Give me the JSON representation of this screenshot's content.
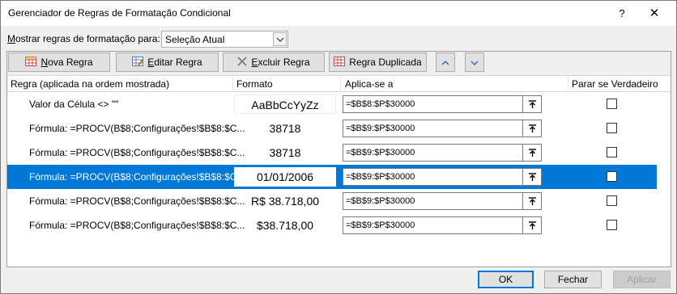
{
  "window": {
    "title": "Gerenciador de Regras de Formatação Condicional",
    "help_glyph": "?",
    "close_glyph": "✕"
  },
  "show_rules": {
    "label_acc": "M",
    "label_rest": "ostrar regras de formatação para:",
    "selected": "Seleção Atual"
  },
  "toolbar": {
    "new_acc": "N",
    "new_rest": "ova Regra",
    "edit_acc": "E",
    "edit_rest": "ditar Regra",
    "delete_acc": "E",
    "delete_rest": "xcluir Regra",
    "duplicate_label": "Regra Duplicada",
    "move_up_glyph": "∧",
    "move_down_glyph": "∨"
  },
  "columns": {
    "rule": "Regra (aplicada na ordem mostrada)",
    "format": "Formato",
    "applies_to": "Aplica-se a",
    "stop_if_true": "Parar se Verdadeiro"
  },
  "rules": [
    {
      "rule": "Valor da Célula <> \"\"",
      "preview": "AaBbCcYyZz",
      "applies_to": "=$B$8:$P$30000",
      "stop_if_true": false,
      "selected": false
    },
    {
      "rule": "Fórmula: =PROCV(B$8;Configurações!$B$8:$C...",
      "preview": "38718",
      "applies_to": "=$B$9:$P$30000",
      "stop_if_true": false,
      "selected": false
    },
    {
      "rule": "Fórmula: =PROCV(B$8;Configurações!$B$8:$C...",
      "preview": "38718",
      "applies_to": "=$B$9:$P$30000",
      "stop_if_true": false,
      "selected": false
    },
    {
      "rule": "Fórmula: =PROCV(B$8;Configurações!$B$8:$C...",
      "preview": "01/01/2006",
      "applies_to": "=$B$9:$P$30000",
      "stop_if_true": false,
      "selected": true
    },
    {
      "rule": "Fórmula: =PROCV(B$8;Configurações!$B$8:$C...",
      "preview": "R$ 38.718,00",
      "applies_to": "=$B$9:$P$30000",
      "stop_if_true": false,
      "selected": false
    },
    {
      "rule": "Fórmula: =PROCV(B$8;Configurações!$B$8:$C...",
      "preview": "$38.718,00",
      "applies_to": "=$B$9:$P$30000",
      "stop_if_true": false,
      "selected": false
    }
  ],
  "buttons": {
    "ok": "OK",
    "close": "Fechar",
    "apply": "Aplicar"
  },
  "colors": {
    "selection": "#0078d7",
    "dialog_bg": "#f0f0f0"
  }
}
